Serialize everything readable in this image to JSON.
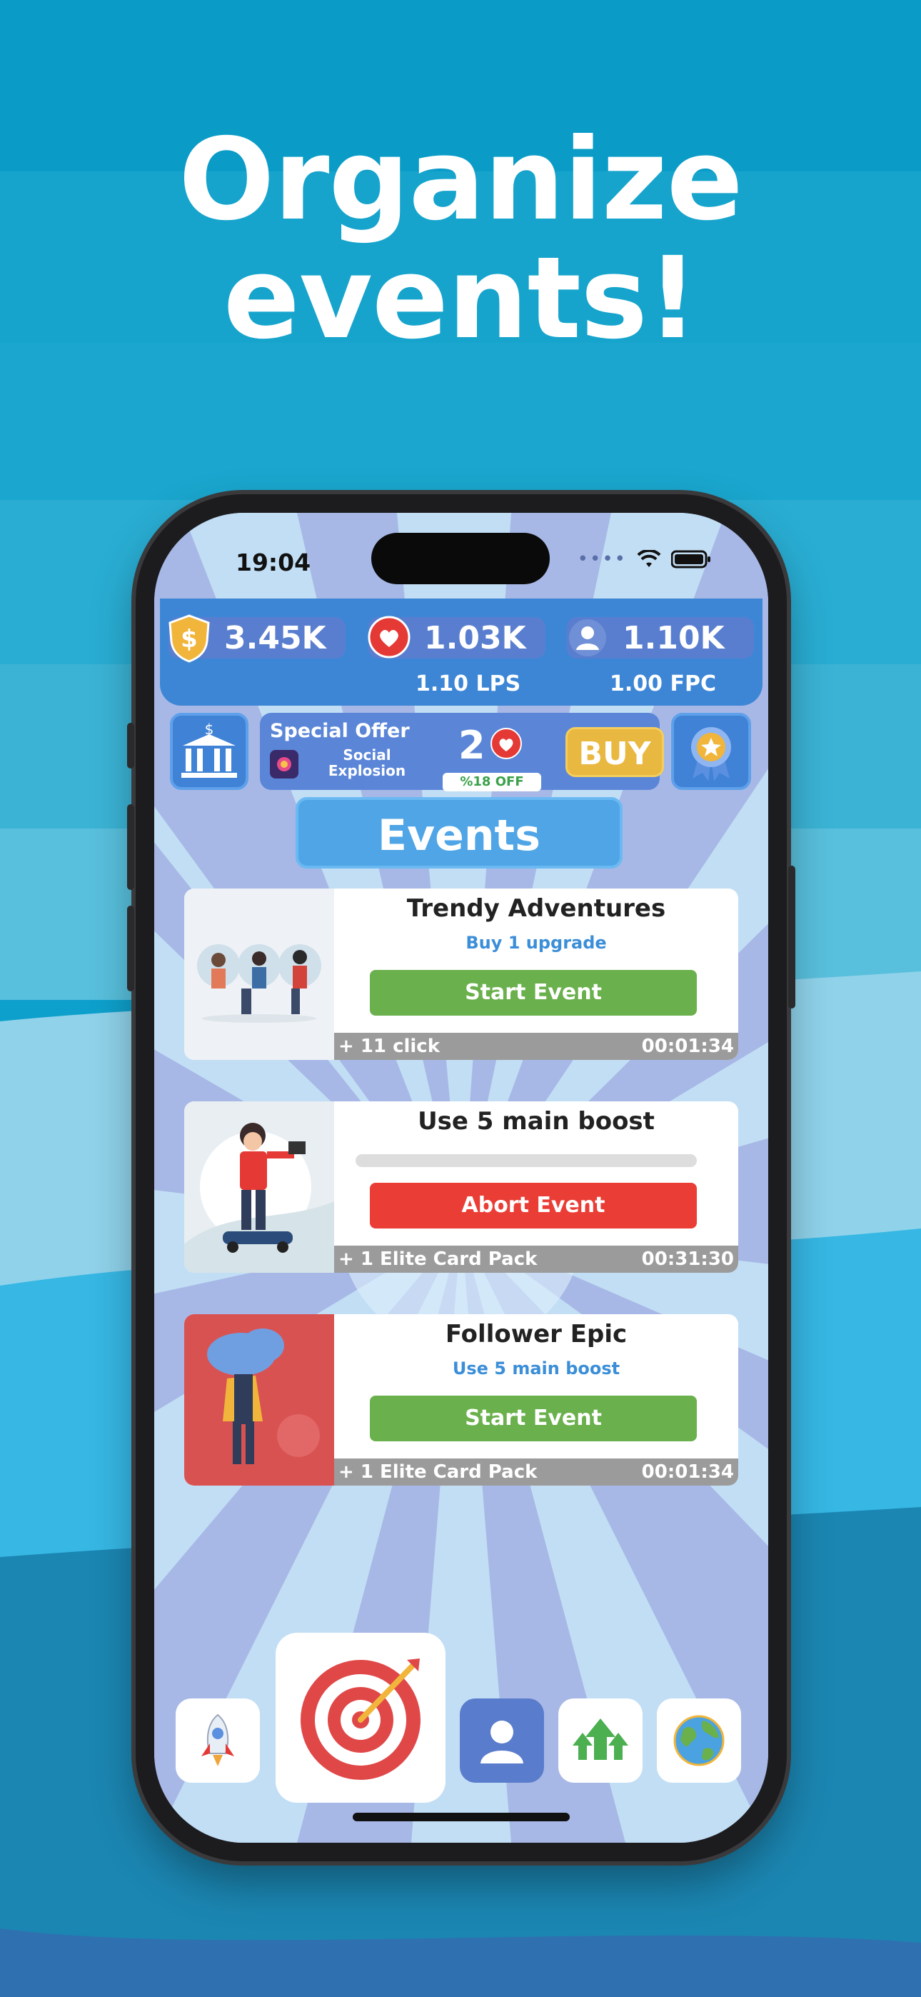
{
  "headline": {
    "line1": "Organize",
    "line2": "events!"
  },
  "status": {
    "time": "19:04"
  },
  "stats": {
    "money": "3.45K",
    "likes": "1.03K",
    "followers": "1.10K",
    "lps": "1.10 LPS",
    "fpc": "1.00 FPC"
  },
  "offer": {
    "title": "Special Offer",
    "name": "Social Explosion",
    "amount": "2",
    "discount": "%18 OFF",
    "buy_label": "BUY"
  },
  "events_title": "Events",
  "events": [
    {
      "title": "Trendy Adventures",
      "subtitle": "Buy 1 upgrade",
      "action": "Start Event",
      "reward": "+ 11 click",
      "time": "00:01:34"
    },
    {
      "title": "Use 5 main boost",
      "subtitle": "",
      "action": "Abort Event",
      "reward": "+ 1 Elite Card Pack",
      "time": "00:31:30"
    },
    {
      "title": "Follower Epic",
      "subtitle": "Use 5 main boost",
      "action": "Start Event",
      "reward": "+ 1 Elite Card Pack",
      "time": "00:01:34"
    }
  ],
  "colors": {
    "accent_green": "#6ab04c",
    "accent_red": "#ea3d35",
    "buy_yellow": "#e9b840"
  },
  "nav": [
    "rocket-icon",
    "target-icon",
    "profile-icon",
    "upgrade-arrows-icon",
    "globe-icon"
  ]
}
